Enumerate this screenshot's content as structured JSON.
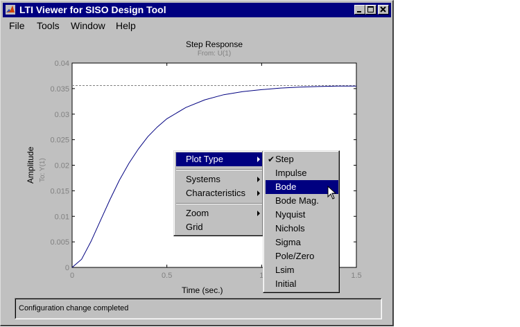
{
  "window": {
    "title": "LTI Viewer for SISO Design Tool"
  },
  "menubar": [
    "File",
    "Tools",
    "Window",
    "Help"
  ],
  "plot": {
    "title": "Step Response",
    "subtitle": "From: U(1)",
    "ylabel": "Amplitude",
    "ylabel_secondary": "To: Y(1)",
    "xlabel": "Time (sec.)",
    "y_ticks": [
      "0.04",
      "0.035",
      "0.03",
      "0.025",
      "0.02",
      "0.015",
      "0.01",
      "0.005",
      "0"
    ],
    "x_ticks": [
      "0",
      "0.5",
      "1",
      "1.5"
    ]
  },
  "chart_data": {
    "type": "line",
    "title": "Step Response",
    "subtitle": "From: U(1)",
    "xlabel": "Time (sec.)",
    "ylabel": "Amplitude",
    "xlim": [
      0,
      1.5
    ],
    "ylim": [
      0,
      0.04
    ],
    "steady_state": 0.0356,
    "series": [
      {
        "color": "#000080",
        "x": [
          0,
          0.05,
          0.1,
          0.15,
          0.2,
          0.25,
          0.3,
          0.35,
          0.4,
          0.45,
          0.5,
          0.6,
          0.7,
          0.8,
          0.9,
          1.0,
          1.1,
          1.2,
          1.3,
          1.4,
          1.5
        ],
        "y": [
          0,
          0.0016,
          0.0051,
          0.0092,
          0.0133,
          0.0171,
          0.0204,
          0.0232,
          0.0256,
          0.0275,
          0.0291,
          0.0313,
          0.0328,
          0.0338,
          0.0344,
          0.0348,
          0.0351,
          0.0353,
          0.0354,
          0.0355,
          0.0355
        ]
      }
    ],
    "colors": {
      "line": "#000080",
      "steady_line": "#808080"
    }
  },
  "context_menu": {
    "items": [
      "Plot Type",
      "Systems",
      "Characteristics",
      "Zoom",
      "Grid"
    ]
  },
  "submenu": {
    "items": [
      "Step",
      "Impulse",
      "Bode",
      "Bode Mag.",
      "Nyquist",
      "Nichols",
      "Sigma",
      "Pole/Zero",
      "Lsim",
      "Initial"
    ],
    "checked": "Step",
    "highlighted": "Bode"
  },
  "status": {
    "text": "Configuration change completed"
  }
}
